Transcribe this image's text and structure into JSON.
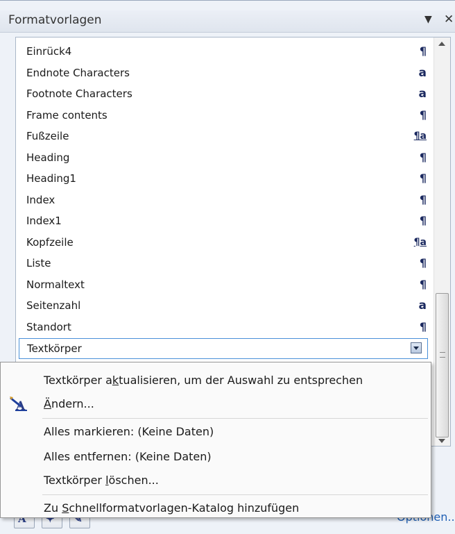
{
  "pane": {
    "title": "Formatvorlagen",
    "menu_arrow": "▼",
    "close_symbol": "✕"
  },
  "styles": [
    {
      "label": "Einrück4",
      "symbol": "¶",
      "kind": "paragraph"
    },
    {
      "label": "Endnote Characters",
      "symbol": "a",
      "kind": "character"
    },
    {
      "label": "Footnote Characters",
      "symbol": "a",
      "kind": "character"
    },
    {
      "label": "Frame contents",
      "symbol": "¶",
      "kind": "paragraph"
    },
    {
      "label": "Fußzeile",
      "symbol": "¶a",
      "kind": "linked"
    },
    {
      "label": "Heading",
      "symbol": "¶",
      "kind": "paragraph"
    },
    {
      "label": "Heading1",
      "symbol": "¶",
      "kind": "paragraph"
    },
    {
      "label": "Index",
      "symbol": "¶",
      "kind": "paragraph"
    },
    {
      "label": "Index1",
      "symbol": "¶",
      "kind": "paragraph"
    },
    {
      "label": "Kopfzeile",
      "symbol": "¶a",
      "kind": "linked"
    },
    {
      "label": "Liste",
      "symbol": "¶",
      "kind": "paragraph"
    },
    {
      "label": "Normaltext",
      "symbol": "¶",
      "kind": "paragraph"
    },
    {
      "label": "Seitenzahl",
      "symbol": "a",
      "kind": "character"
    },
    {
      "label": "Standort",
      "symbol": "¶",
      "kind": "paragraph"
    },
    {
      "label": "Textkörper",
      "symbol": "",
      "kind": "selected"
    }
  ],
  "context_menu": {
    "update": {
      "before": "Textkörper a",
      "accel": "k",
      "after": "tualisieren, um der Auswahl zu entsprechen"
    },
    "modify": {
      "before": "",
      "accel": "Ä",
      "after": "ndern..."
    },
    "select_all": "Alles markieren: (Keine Daten)",
    "remove_all": "Alles entfernen: (Keine Daten)",
    "delete": {
      "before": "Textkörper ",
      "accel": "l",
      "after": "öschen..."
    },
    "add_gallery": {
      "before": "Zu ",
      "accel": "S",
      "after": "chnellformatvorlagen-Katalog hinzufügen"
    }
  },
  "bottom_bar": {
    "options_label": "Optionen..."
  },
  "colors": {
    "symbol": "#1c2a60",
    "selection_border": "#4a90d9",
    "link": "#1f5fb4"
  }
}
